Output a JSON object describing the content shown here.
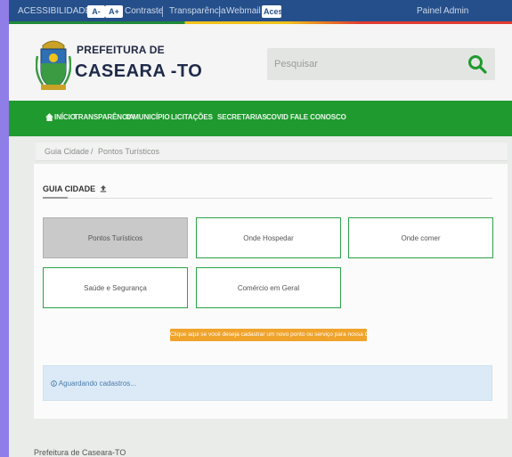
{
  "topbar": {
    "accessibility_label": "ACESSIBILIDADE",
    "font_decrease": "A-",
    "font_increase": "A+",
    "contrast": "Contraste",
    "transparency": "Transparência",
    "webmail": "Webmail",
    "login": "Acesso",
    "admin": "Painel Admin"
  },
  "header": {
    "brand_top": "PREFEITURA DE",
    "brand_main": "CASEARA -TO",
    "search_placeholder": "Pesquisar"
  },
  "nav": {
    "items": [
      "INÍCIO",
      "TRANSPARÊNCIA",
      "O MUNICÍPIO",
      "LICITAÇÕES",
      "SECRETARIAS",
      "COVID",
      "FALE CONOSCO"
    ]
  },
  "breadcrumb": {
    "first": "Guia Cidade",
    "separator": "/",
    "second": "Pontos Turísticos"
  },
  "section": {
    "title": "GUIA CIDADE"
  },
  "tiles": [
    {
      "label": "Pontos Turísticos",
      "active": true
    },
    {
      "label": "Onde Hospedar",
      "active": false
    },
    {
      "label": "Onde comer",
      "active": false
    },
    {
      "label": "Saúde e Segurança",
      "active": false
    },
    {
      "label": "Comércio em Geral",
      "active": false
    }
  ],
  "notice": {
    "text": "Clique aqui se você deseja cadastrar um novo ponto ou serviço para nossa Guia"
  },
  "info": {
    "text": "Aguardando cadastros..."
  },
  "footer": {
    "text": "Prefeitura de Caseara-TO"
  },
  "colors": {
    "topbar": "#254f8a",
    "nav": "#1f9a2e",
    "accent_green": "#2da24a",
    "notice": "#f0a32b",
    "info": "#dbeaf6",
    "frame": "#8f7de8"
  }
}
